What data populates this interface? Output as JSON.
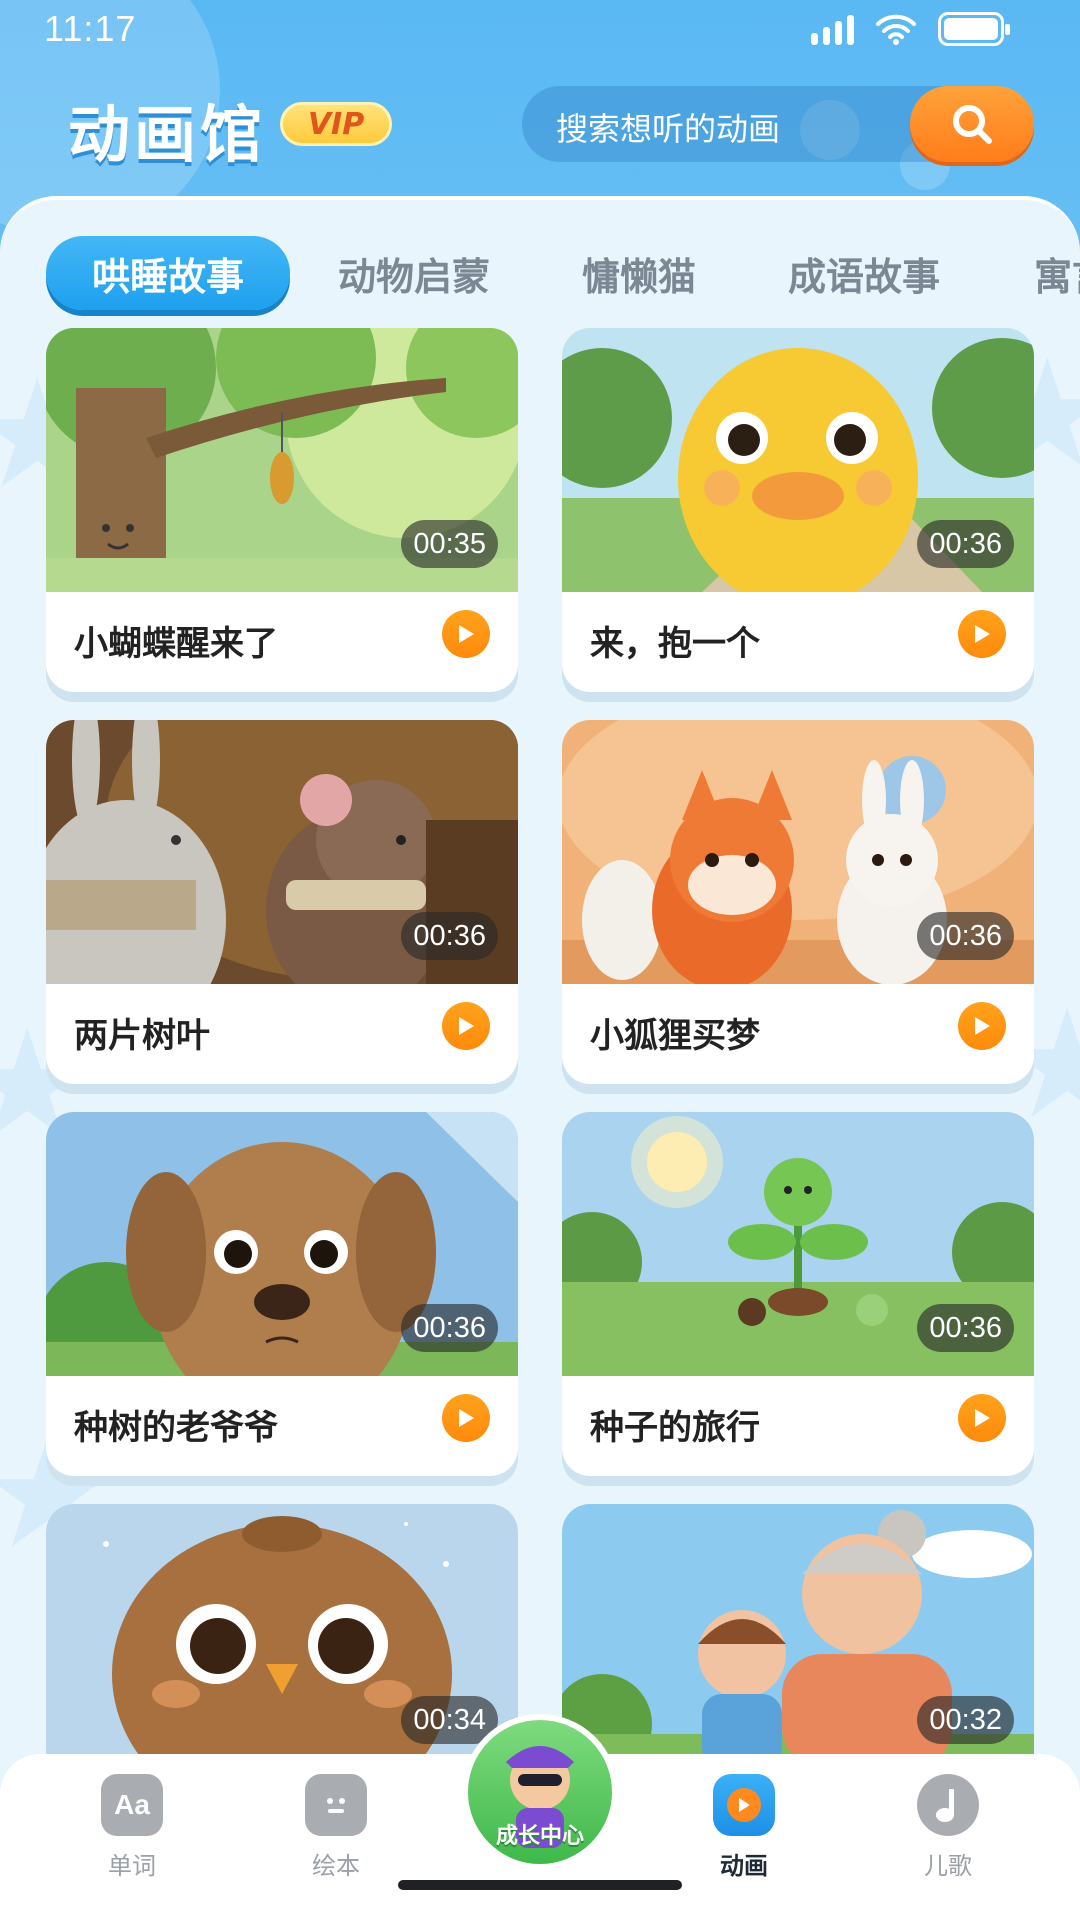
{
  "status_bar": {
    "time": "11:17",
    "icons": [
      "signal-icon",
      "wifi-icon",
      "battery-icon"
    ]
  },
  "header": {
    "title": "动画馆",
    "vip_label": "VIP",
    "search": {
      "placeholder": "搜索想听的动画",
      "button_icon": "search-icon"
    }
  },
  "tabs": [
    {
      "label": "哄睡故事",
      "active": true
    },
    {
      "label": "动物启蒙",
      "active": false
    },
    {
      "label": "慵懒猫",
      "active": false
    },
    {
      "label": "成语故事",
      "active": false
    },
    {
      "label": "寓言",
      "active": false
    }
  ],
  "videos": [
    {
      "title": "小蝴蝶醒来了",
      "duration": "00:35",
      "scene": "tree-cocoon"
    },
    {
      "title": "来，抱一个",
      "duration": "00:36",
      "scene": "duckling"
    },
    {
      "title": "两片树叶",
      "duration": "00:36",
      "scene": "rabbit-mouse"
    },
    {
      "title": "小狐狸买梦",
      "duration": "00:36",
      "scene": "fox-bunny"
    },
    {
      "title": "种树的老爷爷",
      "duration": "00:36",
      "scene": "puppy"
    },
    {
      "title": "种子的旅行",
      "duration": "00:36",
      "scene": "sprout"
    },
    {
      "title": "",
      "duration": "00:34",
      "scene": "owl"
    },
    {
      "title": "",
      "duration": "00:32",
      "scene": "grandma-boy"
    }
  ],
  "bottom_nav": {
    "items": [
      {
        "label": "单词",
        "icon": "word-card-icon",
        "active": false
      },
      {
        "label": "绘本",
        "icon": "picture-book-icon",
        "active": false
      },
      {
        "label": "动画",
        "icon": "tv-icon",
        "active": true
      },
      {
        "label": "儿歌",
        "icon": "music-note-icon",
        "active": false
      }
    ],
    "center": {
      "label": "成长中心",
      "icon": "growth-avatar-icon"
    }
  },
  "colors": {
    "header_blue": "#5ab8f3",
    "tab_active": "#1ea0ee",
    "accent_orange": "#ff8a0c",
    "panel_bg": "#e8f5fd"
  }
}
